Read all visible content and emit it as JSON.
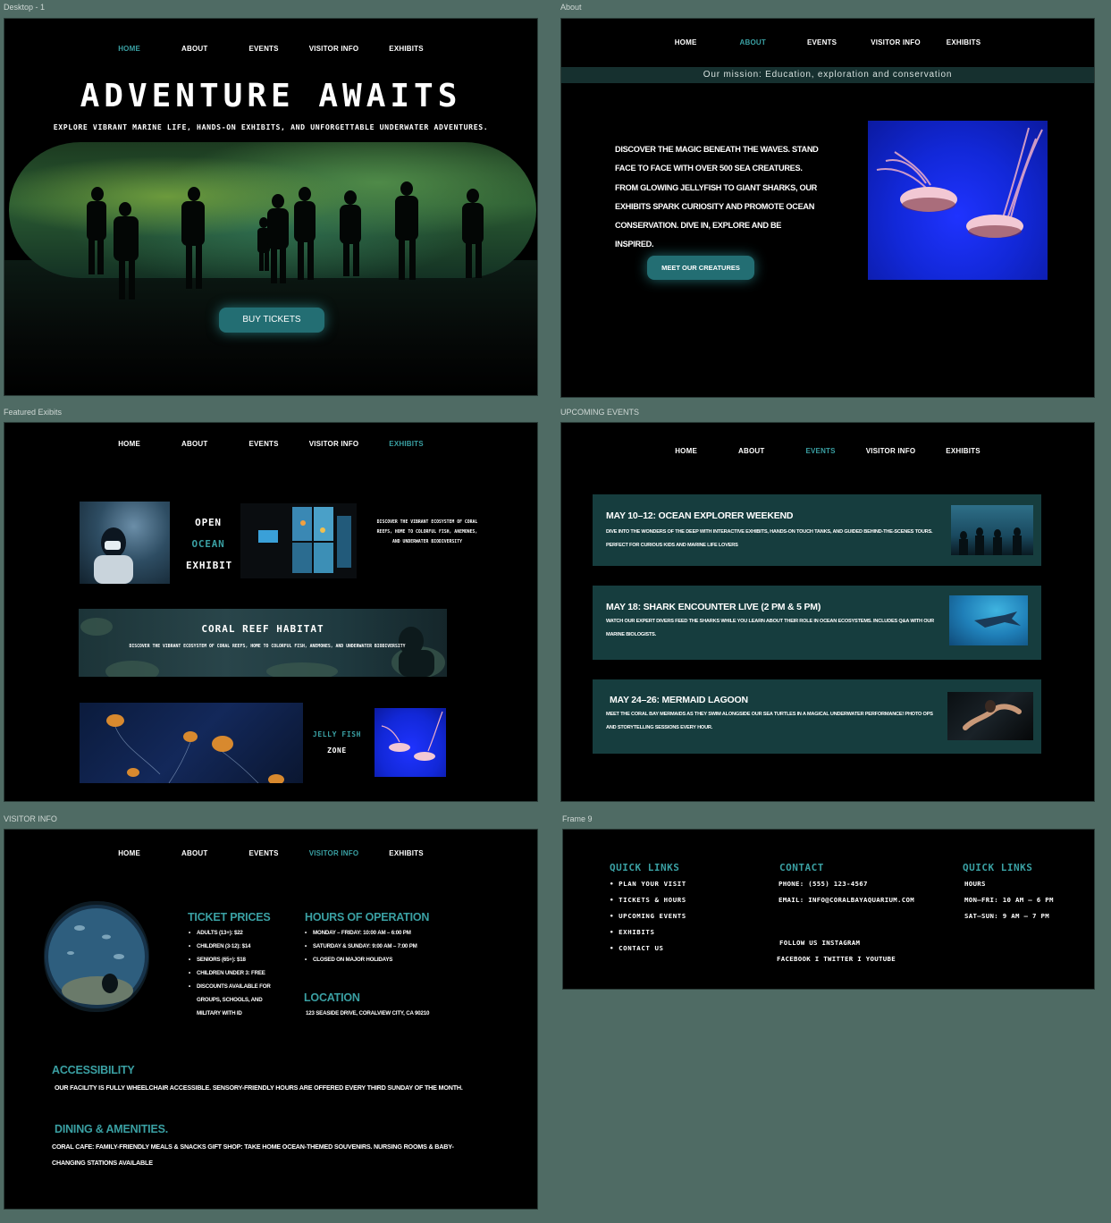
{
  "labels": {
    "desktop1": "Desktop - 1",
    "about": "About",
    "featured": "Featured Exibits",
    "upcoming": "UPCOMING EVENTS",
    "visitor": "VISITOR INFO",
    "frame9": "Frame 9"
  },
  "nav": {
    "home": "HOME",
    "about": "ABOUT",
    "events": "EVENTS",
    "visitor_info": "VISITOR INFO",
    "exhibits": "EXHIBITS"
  },
  "hero": {
    "title": "ADVENTURE AWAITS",
    "subtitle": "EXPLORE VIBRANT MARINE LIFE, HANDS-ON EXHIBITS, AND UNFORGETTABLE UNDERWATER ADVENTURES.",
    "button": "BUY TICKETS"
  },
  "about": {
    "mission": "Our mission: Education, exploration and conservation",
    "paragraph": "DISCOVER THE MAGIC BENEATH THE WAVES. STAND FACE TO FACE WITH OVER 500 SEA CREATURES. FROM GLOWING JELLYFISH TO GIANT SHARKS, OUR EXHIBITS SPARK CURIOSITY AND PROMOTE OCEAN CONSERVATION. DIVE IN, EXPLORE AND BE INSPIRED.",
    "button": "MEET OUR CREATURES"
  },
  "exhibits": {
    "open_line1": "OPEN",
    "open_line2": "OCEAN",
    "open_line3": "EXHIBIT",
    "open_desc": "DISCOVER THE VIBRANT ECOSYSTEM OF CORAL REEFS, HOME TO COLORFUL FISH, ANEMONES, AND UNDERWATER BIODIVERSITY",
    "coral_title": "CORAL REEF HABITAT",
    "coral_desc": "DISCOVER THE VIBRANT ECOSYSTEM OF CORAL REEFS, HOME TO COLORFUL FISH, ANEMONES, AND UNDERWATER BIODIVERSITY",
    "jelly_line1": "JELLY FISH",
    "jelly_line2": "ZONE"
  },
  "events": [
    {
      "title": "MAY 10–12: OCEAN EXPLORER WEEKEND",
      "desc": "DIVE INTO THE WONDERS OF THE DEEP WITH INTERACTIVE EXHIBITS, HANDS-ON TOUCH TANKS, AND GUIDED BEHIND-THE-SCENES TOURS. PERFECT FOR CURIOUS KIDS AND MARINE LIFE LOVERS"
    },
    {
      "title": "MAY 18: SHARK ENCOUNTER LIVE (2 PM & 5 PM)",
      "desc": "WATCH OUR EXPERT DIVERS FEED THE SHARKS WHILE YOU LEARN ABOUT THEIR ROLE IN OCEAN ECOSYSTEMS. INCLUDES Q&A WITH OUR MARINE BIOLOGISTS."
    },
    {
      "title": "MAY 24–26: MERMAID LAGOON",
      "desc": "MEET THE CORAL BAY MERMAIDS AS THEY SWIM ALONGSIDE OUR SEA TURTLES IN A MAGICAL UNDERWATER PERFORMANCE! PHOTO OPS AND STORYTELLING SESSIONS EVERY HOUR."
    }
  ],
  "visitor": {
    "ticket_heading": "TICKET PRICES",
    "tickets": [
      "ADULTS (13+): $22",
      "CHILDREN (3-12): $14",
      "SENIORS (65+): $18",
      "CHILDREN UNDER 3: FREE",
      "DISCOUNTS AVAILABLE FOR GROUPS, SCHOOLS, AND MILITARY WITH ID"
    ],
    "hours_heading": "HOURS OF OPERATION",
    "hours": [
      "MONDAY – FRIDAY: 10:00 AM – 6:00 PM",
      "SATURDAY & SUNDAY: 9:00 AM – 7:00 PM",
      "CLOSED ON MAJOR HOLIDAYS"
    ],
    "location_heading": "LOCATION",
    "location": "123 SEASIDE DRIVE, CORALVIEW CITY, CA 90210",
    "access_heading": "ACCESSIBILITY",
    "access": "OUR FACILITY IS FULLY WHEELCHAIR ACCESSIBLE. SENSORY-FRIENDLY HOURS ARE OFFERED EVERY THIRD SUNDAY OF THE MONTH.",
    "dining_heading": "DINING & AMENITIES.",
    "dining": "CORAL CAFE: FAMILY-FRIENDLY MEALS & SNACKS GIFT SHOP: TAKE HOME OCEAN-THEMED SOUVENIRS.  NURSING ROOMS & BABY-CHANGING STATIONS AVAILABLE"
  },
  "footer": {
    "quick_heading": "QUICK LINKS",
    "links": [
      "PLAN YOUR VISIT",
      "TICKETS & HOURS",
      "UPCOMING EVENTS",
      "EXHIBITS",
      "CONTACT US"
    ],
    "contact_heading": "CONTACT",
    "phone": "PHONE: (555) 123-4567",
    "email": "EMAIL: INFO@CORALBAYAQUARIUM.COM",
    "follow": "FOLLOW US INSTAGRAM",
    "social": "FACEBOOK I TWITTER I YOUTUBE",
    "hours_heading": "QUICK LINKS",
    "hours_label": "HOURS",
    "weekday": "MON–FRI: 10 AM – 6 PM",
    "weekend": "SAT–SUN: 9 AM – 7 PM"
  },
  "colors": {
    "accent": "#3aa0a3",
    "button": "#236e73",
    "event_card": "#163d3e",
    "canvas": "#4f6b64"
  }
}
